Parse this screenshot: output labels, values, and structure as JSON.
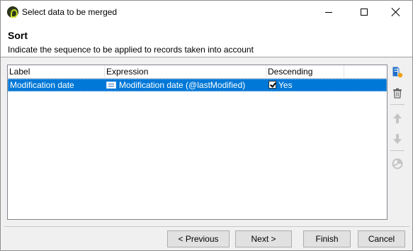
{
  "window": {
    "title": "Select data to be merged"
  },
  "header": {
    "title": "Sort",
    "subtitle": "Indicate the sequence to be applied to records taken into account"
  },
  "table": {
    "columns": [
      "Label",
      "Expression",
      "Descending"
    ],
    "rows": [
      {
        "label": "Modification date",
        "expression": "Modification date (@lastModified)",
        "descending_checked": true,
        "descending": "Yes",
        "selected": true
      }
    ]
  },
  "toolbar": {
    "icons": [
      "add-sort-icon",
      "delete-icon",
      "move-up-icon",
      "move-down-icon",
      "distribution-icon"
    ]
  },
  "footer": {
    "previous_label": "< Previous",
    "next_label": "Next >",
    "finish_label": "Finish",
    "cancel_label": "Cancel"
  },
  "colors": {
    "selection": "#0078d7",
    "accent": "#1e6fc8"
  }
}
